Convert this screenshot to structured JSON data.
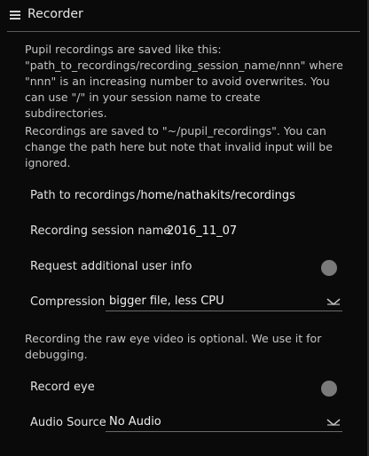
{
  "header": {
    "title": "Recorder"
  },
  "info": {
    "recordings_format": "Pupil recordings are saved like this: \"path_to_recordings/recording_session_name/nnn\" where \"nnn\" is an increasing number to avoid overwrites. You can use \"/\" in your session name to create subdirectories.",
    "recordings_path": "Recordings are saved to \"~/pupil_recordings\". You can change the path here but note that invalid input will be ignored.",
    "eye_video": "Recording the raw eye video is optional. We use it for debugging."
  },
  "settings": {
    "path_label": "Path to recordings",
    "path_value": "/home/nathakits/recordings",
    "session_label": "Recording session name",
    "session_value": "2016_11_07",
    "user_info_label": "Request additional user info",
    "compression_label": "Compression",
    "compression_value": "bigger file, less CPU",
    "record_eye_label": "Record eye",
    "audio_label": "Audio Source",
    "audio_value": "No Audio"
  },
  "icons": {
    "menu": "hamburger-icon",
    "dropdown": "chevron-down-icon"
  },
  "colors": {
    "background": "#0a0a0a",
    "text": "#dcdcdc",
    "toggle_off": "#7a7a7a"
  }
}
